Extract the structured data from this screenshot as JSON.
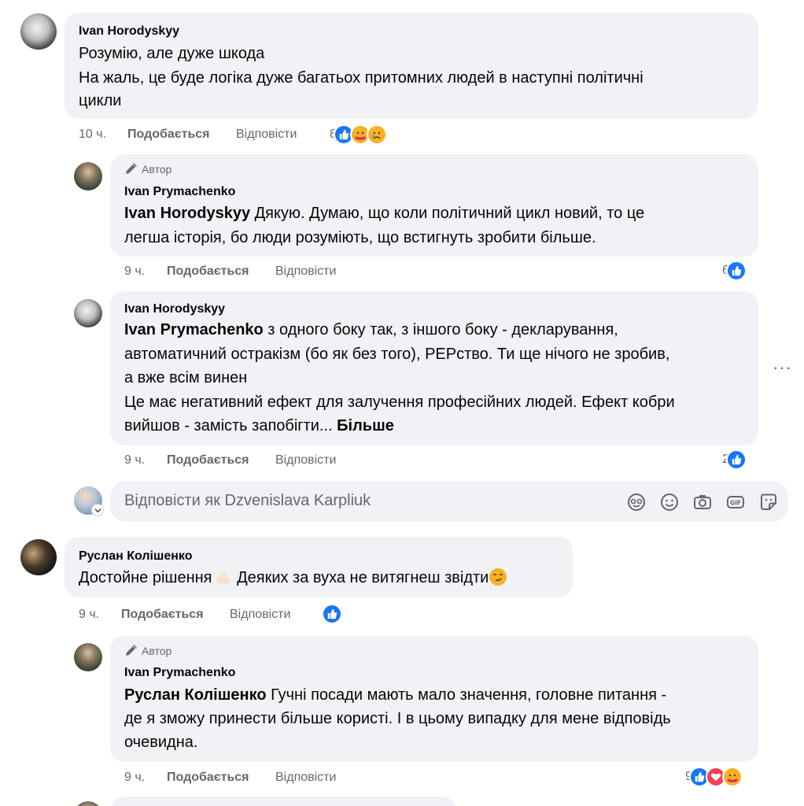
{
  "comments": [
    {
      "author": "Ivan Horodyskyy",
      "lines": [
        "Розумію, але дуже шкода",
        "На жаль, це буде логіка дуже багатьох притомних людей в наступні політичні",
        "цикли"
      ],
      "time": "10 ч.",
      "like_label": "Подобається",
      "reply_label": "Відповісти",
      "reactions_count": "8",
      "reactions": [
        "like-icon",
        "care-icon",
        "sad-icon"
      ],
      "replies": [
        {
          "badge": "Автор",
          "author": "Ivan Prymachenko",
          "mention": "Ivan Horodyskyy",
          "line1": " Дякую. Думаю, що коли політичний цикл новий, то це",
          "line2": "легша історія, бо люди розуміють, що встигнуть зробити більше.",
          "time": "9 ч.",
          "like_label": "Подобається",
          "reply_label": "Відповісти",
          "reactions_count": "6"
        },
        {
          "author": "Ivan Horodyskyy",
          "mention": "Ivan Prymachenko",
          "line1": " з одного боку так, з іншого боку - декларування,",
          "line2": "автоматичний остракізм (бо як без того), РЕРство. Ти ще нічого не зробив,",
          "line3": "а вже всім винен",
          "line4": "Це має негативний ефект для залучення професійних людей. Ефект кобри",
          "line5": "вийшов - замість запобігти...",
          "more": "Більше",
          "time": "9 ч.",
          "like_label": "Подобається",
          "reply_label": "Відповісти",
          "reactions_count": "2"
        }
      ],
      "composer_placeholder": "Відповісти як Dzvenislava Karpliuk"
    },
    {
      "author": "Руслан Колішенко",
      "line1": "Достойне рішення",
      "line1b": " Деяких за вуха не витягнеш звідти",
      "time": "9 ч.",
      "like_label": "Подобається",
      "reply_label": "Відповісти",
      "replies": [
        {
          "badge": "Автор",
          "author": "Ivan Prymachenko",
          "mention": "Руслан Колішенко",
          "line1": " Гучні посади мають мало значення, головне питання -",
          "line2": "де я зможу принести більше користі. І в цьому випадку для мене відповідь",
          "line3": "очевидна.",
          "time": "9 ч.",
          "like_label": "Подобається",
          "reply_label": "Відповісти",
          "reactions_count": "9"
        }
      ]
    }
  ],
  "more_options": "···"
}
